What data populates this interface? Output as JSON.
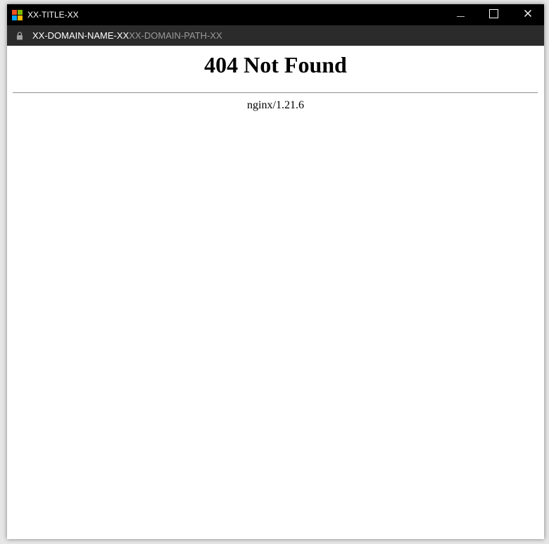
{
  "window": {
    "title": "XX-TITLE-XX",
    "app_icon": "windows-logo-icon",
    "controls": {
      "minimize": "minimize-icon",
      "maximize": "maximize-icon",
      "close": "close-icon"
    }
  },
  "address_bar": {
    "secure_icon": "lock-icon",
    "domain": "XX-DOMAIN-NAME-XX",
    "path": "XX-DOMAIN-PATH-XX"
  },
  "page": {
    "heading": "404 Not Found",
    "server": "nginx/1.21.6"
  },
  "colors": {
    "titlebar": "#000000",
    "addressbar": "#2b2b2b",
    "url_domain": "#ffffff",
    "url_path": "#9a9a9a",
    "page_background": "#ffffff",
    "logo_red": "#f25022",
    "logo_green": "#7fba00",
    "logo_blue": "#00a4ef",
    "logo_yellow": "#ffb900"
  }
}
